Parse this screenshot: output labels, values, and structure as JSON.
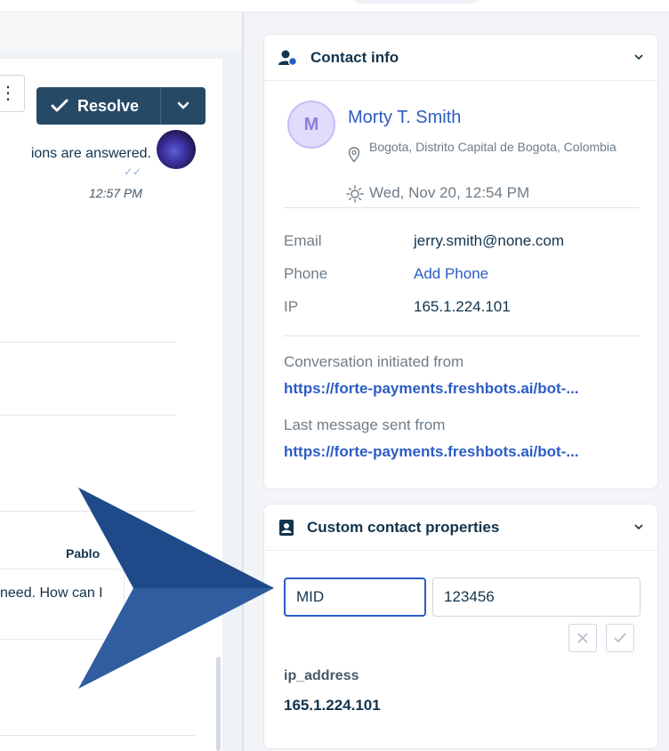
{
  "left": {
    "more_label": "⋮",
    "resolve_label": "Resolve",
    "message_text": "ions are answered.",
    "message_time": "12:57 PM",
    "sender_name": "Pablo",
    "bubble_text": "need. How can I"
  },
  "contact_info": {
    "title": "Contact info",
    "avatar_initial": "M",
    "name": "Morty T. Smith",
    "location": "Bogota, Distrito Capital de Bogota, Colombia",
    "local_time": "Wed, Nov 20, 12:54 PM",
    "fields": [
      {
        "label": "Email",
        "value": "jerry.smith@none.com"
      },
      {
        "label": "Phone",
        "value": "Add Phone"
      },
      {
        "label": "IP",
        "value": "165.1.224.101"
      }
    ],
    "initiated_label": "Conversation initiated from",
    "initiated_url": "https://forte-payments.freshbots.ai/bot-...",
    "last_label": "Last message sent from",
    "last_url": "https://forte-payments.freshbots.ai/bot-..."
  },
  "custom_props": {
    "title": "Custom contact properties",
    "key_input": "MID",
    "value_input": "123456",
    "prop_name": "ip_address",
    "prop_value": "165.1.224.101"
  },
  "colors": {
    "accent": "#2c5cc5",
    "resolve_bg": "#264966",
    "arrow": "#2f5da0"
  }
}
